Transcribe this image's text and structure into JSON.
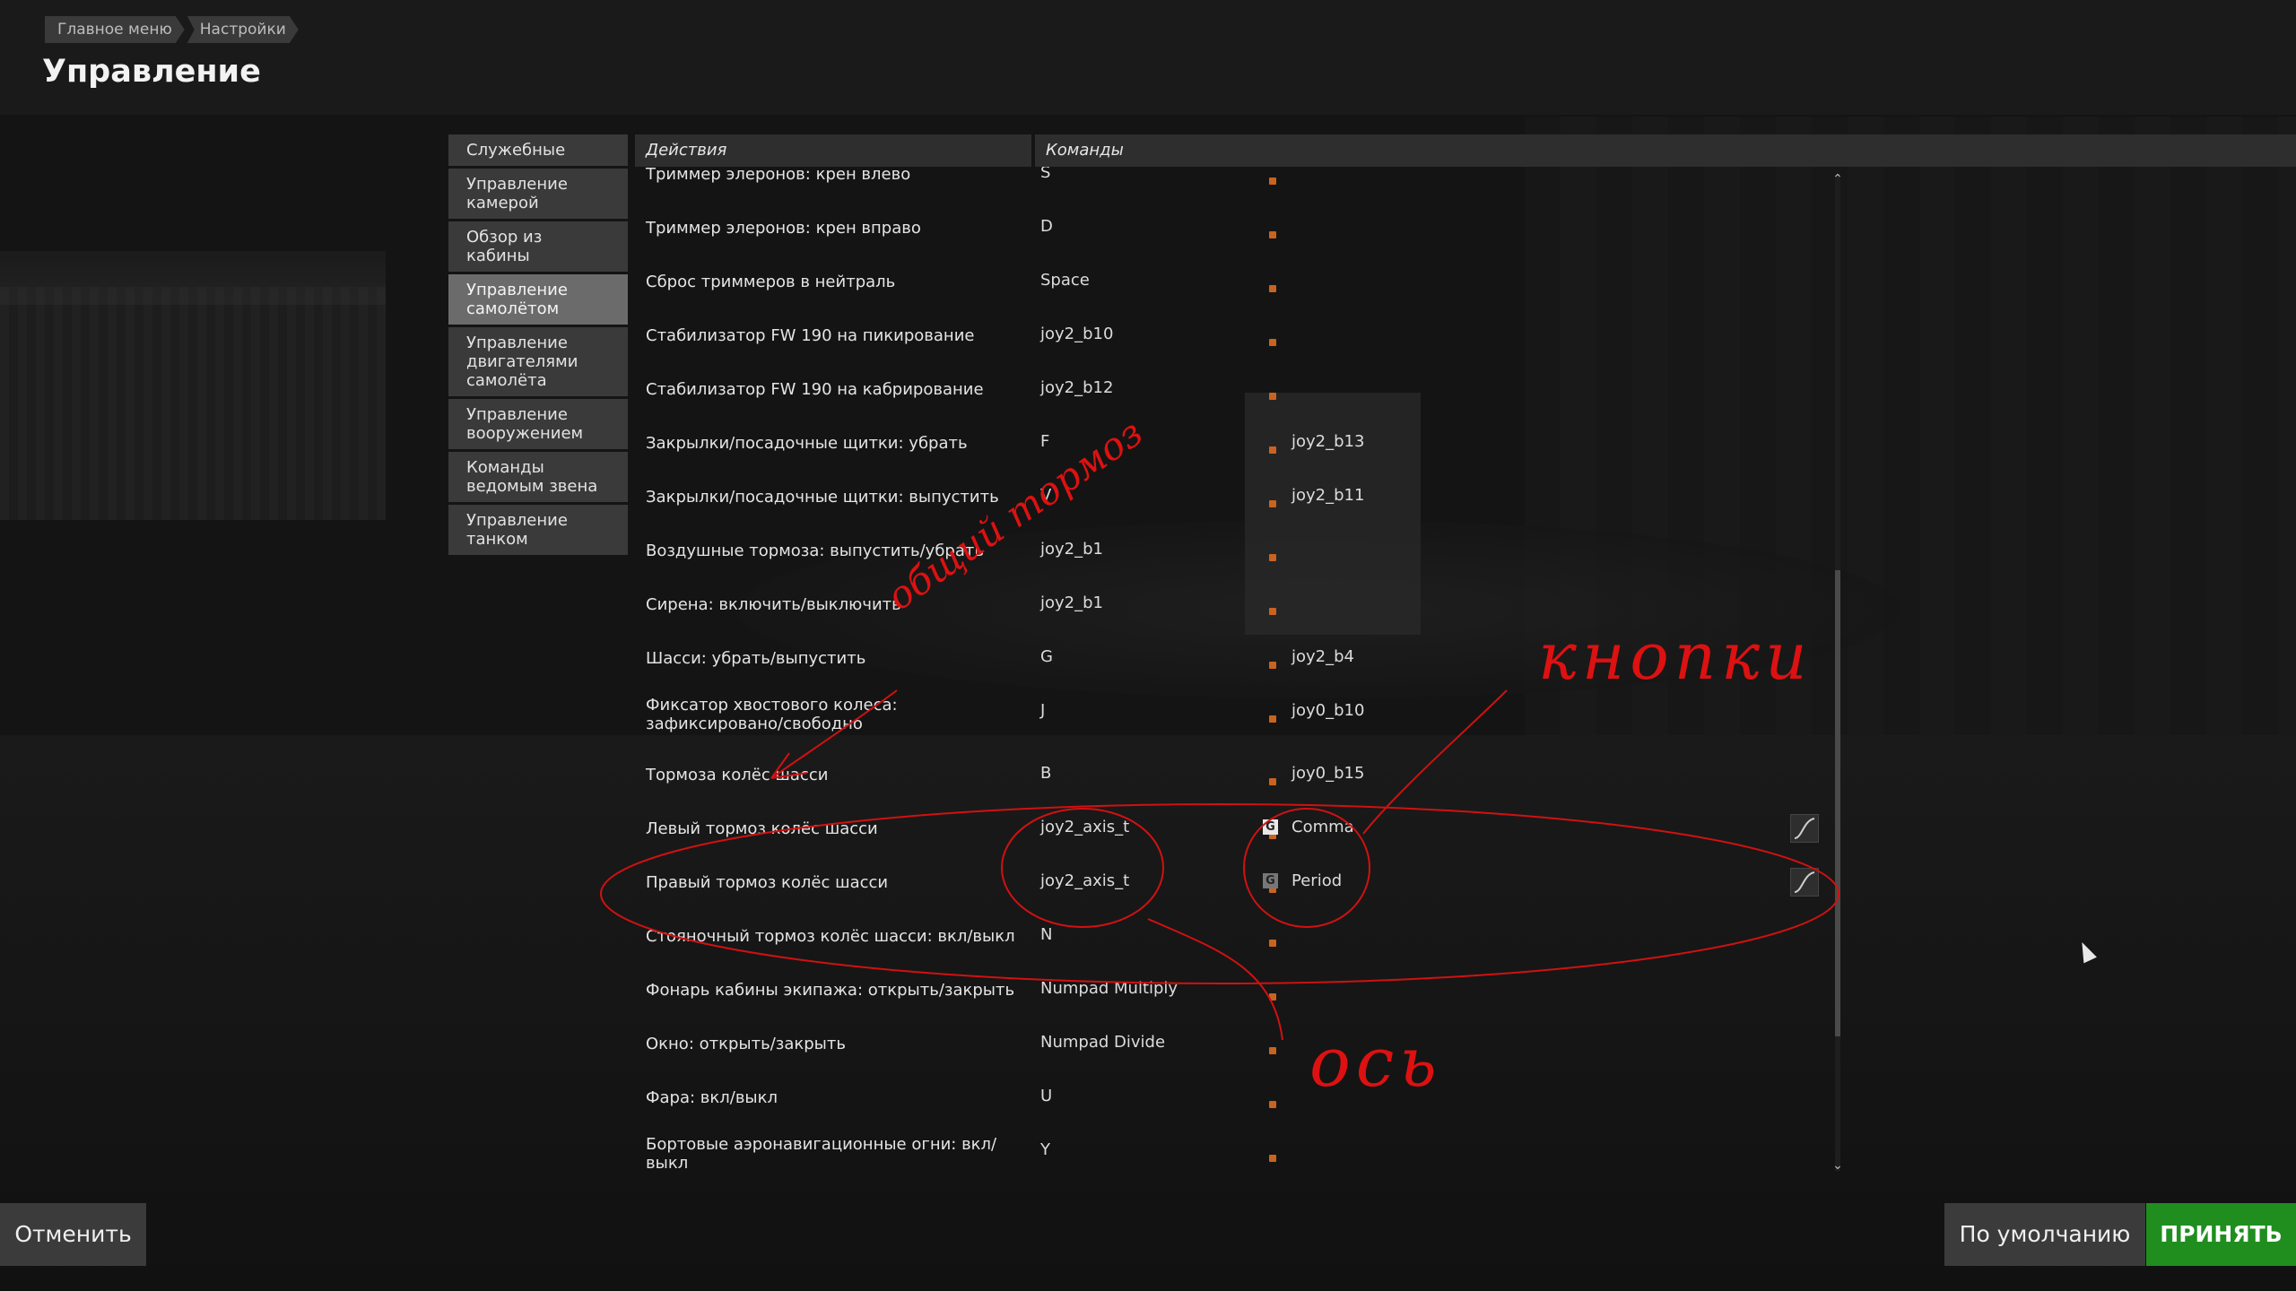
{
  "breadcrumb": [
    "Главное меню",
    "Настройки"
  ],
  "title": "Управление",
  "sidebar": {
    "items": [
      {
        "label": "Служебные",
        "active": false
      },
      {
        "label": "Управление камерой",
        "active": false
      },
      {
        "label": "Обзор из кабины",
        "active": false
      },
      {
        "label": "Управление самолётом",
        "active": true
      },
      {
        "label": "Управление двигателями самолёта",
        "active": false
      },
      {
        "label": "Управление вооружением",
        "active": false
      },
      {
        "label": "Команды ведомым звена",
        "active": false
      },
      {
        "label": "Управление танком",
        "active": false
      }
    ]
  },
  "table": {
    "header_actions": "Действия",
    "header_commands": "Команды",
    "rows": [
      {
        "action": "Триммер элеронов: крен влево",
        "key1": "S",
        "key2": ""
      },
      {
        "action": "Триммер элеронов: крен вправо",
        "key1": "D",
        "key2": ""
      },
      {
        "action": "Сброс триммеров в нейтраль",
        "key1": "Space",
        "key2": ""
      },
      {
        "action": "Стабилизатор FW 190 на пикирование",
        "key1": "joy2_b10",
        "key2": ""
      },
      {
        "action": "Стабилизатор FW 190 на кабрирование",
        "key1": "joy2_b12",
        "key2": ""
      },
      {
        "action": "Закрылки/посадочные щитки: убрать",
        "key1": "F",
        "key2": "joy2_b13"
      },
      {
        "action": "Закрылки/посадочные щитки: выпустить",
        "key1": "V",
        "key2": "joy2_b11"
      },
      {
        "action": "Воздушные тормоза: выпустить/убрать",
        "key1": "joy2_b1",
        "key2": ""
      },
      {
        "action": "Сирена: включить/выключить",
        "key1": "joy2_b1",
        "key2": ""
      },
      {
        "action": "Шасси: убрать/выпустить",
        "key1": "G",
        "key2": "joy2_b4"
      },
      {
        "action": "Фиксатор хвостового колеса: зафиксировано/свободно",
        "key1": "J",
        "key2": "joy0_b10"
      },
      {
        "action": "Тормоза колёс шасси",
        "key1": "B",
        "key2": "joy0_b15"
      },
      {
        "action": "Левый тормоз колёс шасси",
        "key1": "joy2_axis_t",
        "key2": "Comma"
      },
      {
        "action": "Правый тормоз колёс шасси",
        "key1": "joy2_axis_t",
        "key2": "Period"
      },
      {
        "action": "Стояночный тормоз колёс шасси: вкл/выкл",
        "key1": "N",
        "key2": ""
      },
      {
        "action": "Фонарь кабины экипажа: открыть/закрыть",
        "key1": "Numpad Multiply",
        "key2": ""
      },
      {
        "action": "Окно: открыть/закрыть",
        "key1": "Numpad Divide",
        "key2": ""
      },
      {
        "action": "Фара: вкл/выкл",
        "key1": "U",
        "key2": ""
      },
      {
        "action": "Бортовые аэронавигационные огни: вкл/выкл",
        "key1": "Y",
        "key2": ""
      }
    ]
  },
  "annotations": {
    "handwritten_left": "общий тормоз",
    "handwritten_buttons": "кнопки",
    "handwritten_axis": "ось",
    "color": "#d11111"
  },
  "buttons": {
    "cancel": "Отменить",
    "default": "По умолчанию",
    "accept": "ПРИНЯТЬ"
  },
  "colors": {
    "accept_bg": "#1f8e1f",
    "bind_marker": "#c86420",
    "annotation": "#d11111"
  }
}
